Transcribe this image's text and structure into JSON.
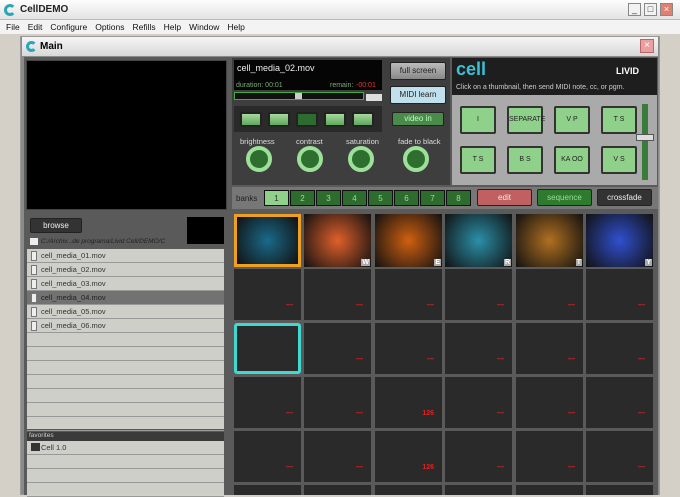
{
  "app": {
    "title": "CellDEMO",
    "menu": [
      "File",
      "Edit",
      "Configure",
      "Options",
      "Refills",
      "Help",
      "Window",
      "Help"
    ]
  },
  "window": {
    "title": "Main"
  },
  "player": {
    "filename": "cell_media_02.mov",
    "duration": "duration: 00:01",
    "remain_label": "remain:",
    "remain": "-00:01",
    "full_screen": "full screen",
    "midi_learn": "MIDI learn",
    "video_in": "video in",
    "knobs": [
      "brightness",
      "contrast",
      "saturation"
    ],
    "fade": "fade to black"
  },
  "cell": {
    "logo": "cell",
    "brand": "LIVID",
    "hint": "Click on a thumbnail, then send MIDI note, cc, or pgm.",
    "pads": [
      "",
      "SEPARATE",
      "",
      "",
      "",
      "",
      "",
      "",
      "",
      "",
      "",
      "",
      "",
      "",
      "",
      ""
    ],
    "pad_labels": [
      "I",
      "SEPARATE",
      "V P",
      "T S",
      "T S",
      "B S",
      "KA OO",
      "V S"
    ]
  },
  "banks": {
    "label": "banks",
    "items": [
      "1",
      "2",
      "3",
      "4",
      "5",
      "6",
      "7",
      "8"
    ],
    "edit": "edit",
    "sequence": "sequence",
    "crossfade": "crossfade"
  },
  "browser": {
    "browse": "browse",
    "path": "C:/Archiv...de programa/Livid Cell/DEMO/C",
    "files": [
      "cell_media_01.mov",
      "cell_media_02.mov",
      "cell_media_03.mov",
      "cell_media_04.mov",
      "cell_media_05.mov",
      "cell_media_06.mov"
    ],
    "selected_index": 3,
    "favorites_label": "favorites",
    "favorites": [
      "Cell 1.0"
    ]
  },
  "thumbs": {
    "keys": [
      "",
      "W",
      "E",
      "R",
      "T",
      "Y"
    ],
    "colors": [
      "#1a6a8a",
      "#e0602a",
      "#d06010",
      "#2a90a8",
      "#b07020",
      "#3050d0"
    ]
  },
  "grid": [
    [
      "—",
      "—",
      "—",
      "—",
      "—",
      "—"
    ],
    [
      "",
      "—",
      "—",
      "—",
      "—",
      "—"
    ],
    [
      "—",
      "—",
      "126",
      "—",
      "—",
      "—"
    ],
    [
      "—",
      "—",
      "126",
      "—",
      "—",
      "—"
    ]
  ]
}
